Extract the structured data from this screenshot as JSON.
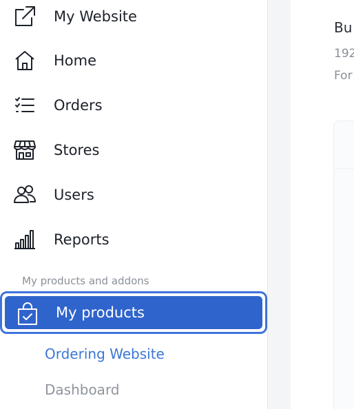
{
  "sidebar": {
    "items": [
      {
        "label": "My Website",
        "icon": "external-link-icon"
      },
      {
        "label": "Home",
        "icon": "home-icon"
      },
      {
        "label": "Orders",
        "icon": "list-icon"
      },
      {
        "label": "Stores",
        "icon": "store-icon"
      },
      {
        "label": "Users",
        "icon": "users-icon"
      },
      {
        "label": "Reports",
        "icon": "bar-chart-icon"
      }
    ],
    "section_label": "My products and addons",
    "active_item": {
      "label": "My products",
      "icon": "shopping-bag-check-icon"
    },
    "subitems": [
      {
        "label": "Ordering Website",
        "state": "selected"
      },
      {
        "label": "Dashboard",
        "state": "default"
      }
    ]
  },
  "main": {
    "line1": "Bu",
    "line2": "192",
    "line3": "For"
  },
  "colors": {
    "accent": "#2f64cc",
    "accent_border": "#3e73dd",
    "link_blue": "#3b76d6",
    "muted": "#8a8f98"
  }
}
